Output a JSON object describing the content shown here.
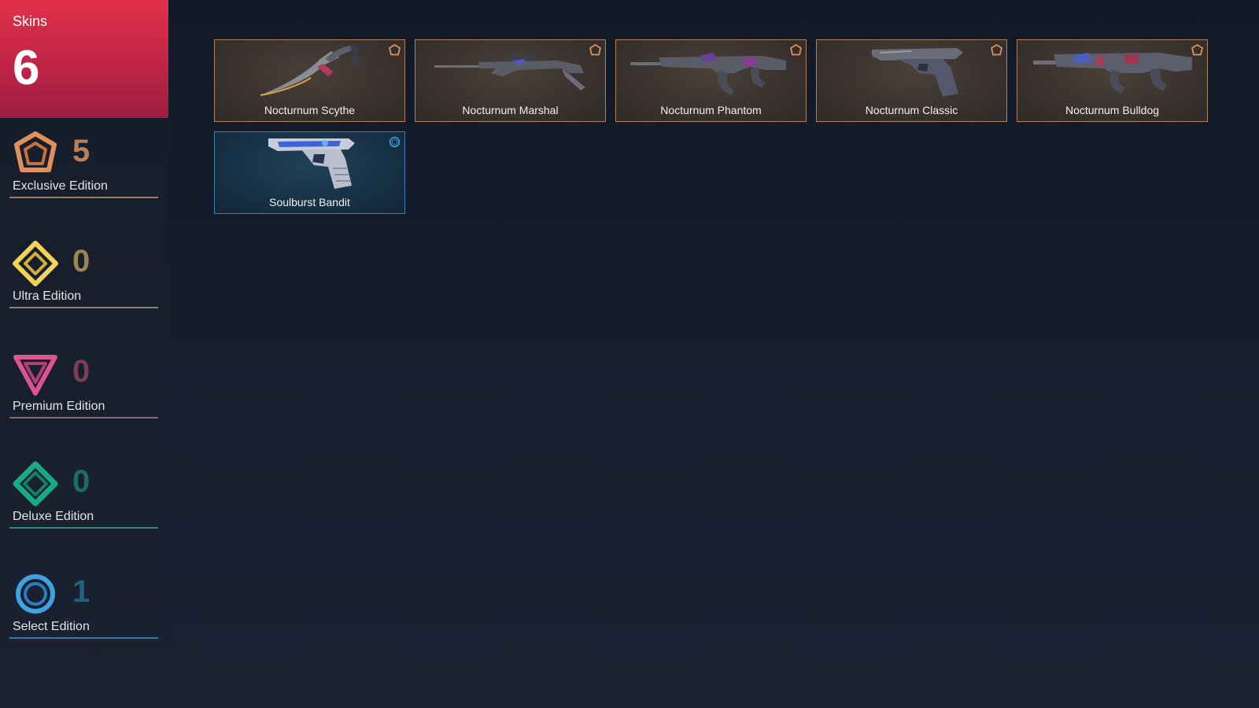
{
  "summary": {
    "label": "Skins",
    "count": "6"
  },
  "tiers": [
    {
      "key": "exclusive",
      "name": "Exclusive Edition",
      "count": "5",
      "color": "#e0905a",
      "count_color": "#b8805a",
      "line_color": "#9a7a68",
      "icon": "exclusive-edition-icon"
    },
    {
      "key": "ultra",
      "name": "Ultra Edition",
      "count": "0",
      "color": "#f1d35a",
      "count_color": "#9a8550",
      "line_color": "#8a8478",
      "icon": "ultra-edition-icon"
    },
    {
      "key": "premium",
      "name": "Premium Edition",
      "count": "0",
      "color": "#d9568e",
      "count_color": "#7a3d5a",
      "line_color": "#8a6478",
      "icon": "premium-edition-icon"
    },
    {
      "key": "deluxe",
      "name": "Deluxe Edition",
      "count": "0",
      "color": "#19a88a",
      "count_color": "#1d6e62",
      "line_color": "#2d8a7a",
      "icon": "deluxe-edition-icon"
    },
    {
      "key": "select",
      "name": "Select Edition",
      "count": "1",
      "color": "#3ea3e0",
      "count_color": "#24607e",
      "line_color": "#3a78a0",
      "icon": "select-edition-icon"
    }
  ],
  "skins": [
    {
      "name": "Nocturnum Scythe",
      "tier": "exclusive",
      "art": "knife-icon"
    },
    {
      "name": "Nocturnum Marshal",
      "tier": "exclusive",
      "art": "sniper-rifle-icon"
    },
    {
      "name": "Nocturnum Phantom",
      "tier": "exclusive",
      "art": "assault-rifle-icon"
    },
    {
      "name": "Nocturnum Classic",
      "tier": "exclusive",
      "art": "pistol-icon"
    },
    {
      "name": "Nocturnum Bulldog",
      "tier": "exclusive",
      "art": "rifle-icon"
    },
    {
      "name": "Soulburst Bandit",
      "tier": "select",
      "art": "pistol-icon"
    }
  ]
}
